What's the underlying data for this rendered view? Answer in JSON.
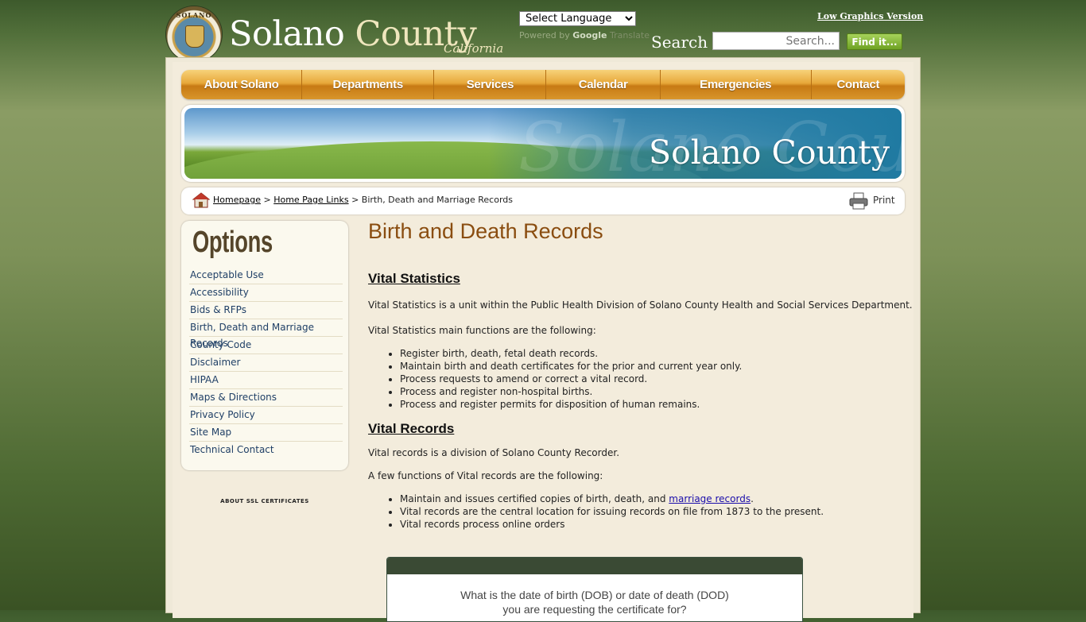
{
  "header": {
    "seal_text": "SOLANO",
    "logo_text_1": "Solano",
    "logo_text_2": "County",
    "logo_sub": "California",
    "language_select": "Select Language",
    "powered_by": "Powered by",
    "google": "Google",
    "translate": "Translate",
    "low_graphics": "Low Graphics Version",
    "search_label": "Search",
    "search_placeholder": "Search...",
    "find_button": "Find it..."
  },
  "nav": {
    "items": [
      {
        "label": "About Solano"
      },
      {
        "label": "Departments"
      },
      {
        "label": "Services"
      },
      {
        "label": "Calendar"
      },
      {
        "label": "Emergencies"
      },
      {
        "label": "Contact"
      }
    ]
  },
  "banner": {
    "title": "Solano County",
    "watermark": "Solano County"
  },
  "breadcrumb": {
    "home": "Homepage",
    "link": "Home Page Links",
    "current": "Birth, Death and Marriage Records",
    "sep": ">",
    "print": "Print"
  },
  "sidebar": {
    "title": "Options",
    "items": [
      {
        "label": "Acceptable Use"
      },
      {
        "label": "Accessibility"
      },
      {
        "label": "Bids & RFPs"
      },
      {
        "label": "Birth, Death and Marriage Records"
      },
      {
        "label": "County Code"
      },
      {
        "label": "Disclaimer"
      },
      {
        "label": "HIPAA"
      },
      {
        "label": "Maps & Directions"
      },
      {
        "label": "Privacy Policy"
      },
      {
        "label": "Site Map"
      },
      {
        "label": "Technical Contact"
      }
    ],
    "ssl": "ABOUT SSL CERTIFICATES"
  },
  "content": {
    "title": "Birth and Death Records",
    "vital_statistics": {
      "heading": "Vital Statistics",
      "intro": "Vital Statistics is a unit within the Public Health Division of Solano County Health and Social Services Department.",
      "functions_intro": "Vital Statistics main functions are the following:",
      "items": [
        "Register birth, death, fetal death records.",
        "Maintain birth and death certificates for the prior and current year only.",
        "Process requests to amend or correct a vital record.",
        "Process and register non-hospital births.",
        "Process and register permits for disposition of human remains."
      ]
    },
    "vital_records": {
      "heading": "Vital Records",
      "intro": "Vital records is a division of Solano County Recorder.",
      "functions_intro": "A few functions of Vital records are the following:",
      "item1_prefix": "Maintain and issues certified copies of birth, death, and ",
      "item1_link": "marriage records",
      "item1_suffix": ".",
      "item2": "Vital records are the central location for issuing records on file from 1873 to the present.",
      "item3": "Vital records process online orders"
    },
    "question": {
      "line1": "What is the date of birth (DOB) or date of death (DOD)",
      "line2": "you are requesting the certificate for?"
    }
  }
}
